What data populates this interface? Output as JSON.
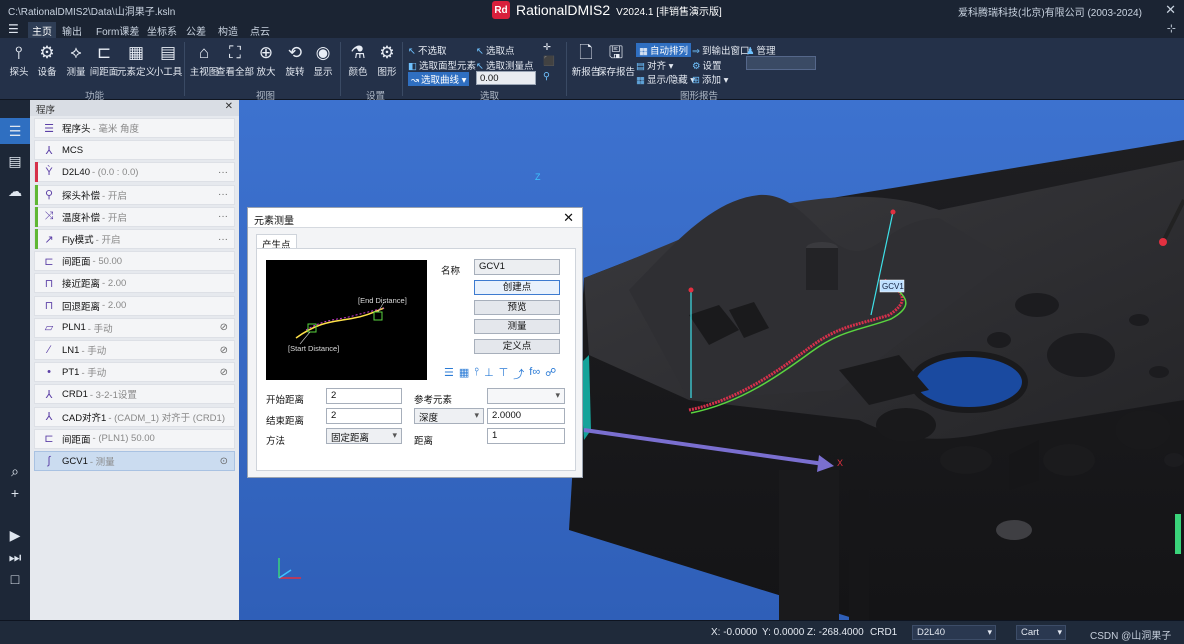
{
  "titlebar": {
    "path": "C:\\RationalDMIS2\\Data\\山洞果子.ksln",
    "logo_text": "Rd",
    "app_name": "RationalDMIS2",
    "version": "V2024.1 [非销售演示版]",
    "company": "爱科腾瑞科技(北京)有限公司 (2003-2024)"
  },
  "menu": {
    "tabs": [
      "主页",
      "输出",
      "Form课差",
      "坐标系",
      "公差",
      "构造",
      "点云"
    ],
    "active": "主页"
  },
  "ribbon": {
    "function": {
      "label": "功能",
      "buttons": [
        "探头",
        "设备",
        "测量",
        "间距面",
        "元素定义",
        "小工具"
      ]
    },
    "view": {
      "label": "视图",
      "buttons": [
        "主视图",
        "查看全部",
        "放大",
        "旋转",
        "显示"
      ]
    },
    "settings": {
      "label": "设置",
      "buttons": [
        "颜色",
        "图形"
      ]
    },
    "select": {
      "label": "选取",
      "items": [
        "不选取",
        "选取面型元素",
        "选取曲线",
        "选取点",
        "选取测量点"
      ],
      "value": "0.00"
    },
    "report": {
      "label": "图形报告",
      "buttons": [
        "新报告",
        "保存报告"
      ],
      "items": [
        "自动排列",
        "对齐",
        "显示/隐藏",
        "到输出窗口",
        "设置",
        "添加",
        "管理"
      ]
    }
  },
  "program": {
    "title": "程序",
    "items": [
      {
        "name": "程序头",
        "desc": "- 毫米 角度",
        "bar": "",
        "icon": "☰"
      },
      {
        "name": "MCS",
        "desc": "",
        "bar": "",
        "icon": "⅄"
      },
      {
        "name": "D2L40",
        "desc": "- (0.0 : 0.0)",
        "bar": "#d6304a",
        "icon": "Ỳ",
        "more": "···"
      },
      {
        "name": "探头补偿",
        "desc": "- 开启",
        "bar": "#5fb733",
        "icon": "⚲",
        "more": "···"
      },
      {
        "name": "温度补偿",
        "desc": "- 开启",
        "bar": "#5fb733",
        "icon": "⤨",
        "more": "···"
      },
      {
        "name": "Fly模式",
        "desc": "- 开启",
        "bar": "#5fb733",
        "icon": "↗",
        "more": "···"
      },
      {
        "name": "间距面",
        "desc": "- 50.00",
        "bar": "",
        "icon": "⊏"
      },
      {
        "name": "接近距离",
        "desc": "- 2.00",
        "bar": "",
        "icon": "⊓"
      },
      {
        "name": "回退距离",
        "desc": "- 2.00",
        "bar": "",
        "icon": "⊓"
      },
      {
        "name": "PLN1",
        "desc": "- 手动",
        "bar": "",
        "icon": "▱",
        "more": "⊘"
      },
      {
        "name": "LN1",
        "desc": "- 手动",
        "bar": "",
        "icon": "∕",
        "more": "⊘"
      },
      {
        "name": "PT1",
        "desc": "- 手动",
        "bar": "",
        "icon": "•",
        "more": "⊘"
      },
      {
        "name": "CRD1",
        "desc": "- 3-2-1设置",
        "bar": "",
        "icon": "⅄"
      },
      {
        "name": "CAD对齐1",
        "desc": "- (CADM_1) 对齐于 (CRD1)",
        "bar": "",
        "icon": "⅄"
      },
      {
        "name": "间距面",
        "desc": "- (PLN1) 50.00",
        "bar": "",
        "icon": "⊏"
      },
      {
        "name": "GCV1",
        "desc": "- 测量",
        "bar": "",
        "icon": "∫",
        "more": "⊙",
        "selected": true
      }
    ]
  },
  "viewport": {
    "feature_label": "GCV1",
    "axis_z": "Z",
    "axis_x": "X"
  },
  "dialog": {
    "title": "元素测量",
    "tab": "产生点",
    "preview_start": "[Start Distance]",
    "preview_end": "[End Distance]",
    "name_label": "名称",
    "name_value": "GCV1",
    "buttons": [
      "创建点",
      "预览",
      "测量",
      "定义点"
    ],
    "start_label": "开始距离",
    "start_value": "2",
    "end_label": "结束距离",
    "end_value": "2",
    "method_label": "方法",
    "method_value": "固定距离",
    "ref_label": "参考元素",
    "ref_value": "",
    "depth_option": "深度",
    "depth_value": "2.0000",
    "distance_label": "距离",
    "distance_value": "1"
  },
  "status": {
    "x": "X: -0.0000",
    "y": "Y: 0.0000",
    "z": "Z: -268.4000",
    "crd": "CRD1",
    "probe": "D2L40",
    "coord": "Cart",
    "watermark": "CSDN @山洞果子"
  }
}
